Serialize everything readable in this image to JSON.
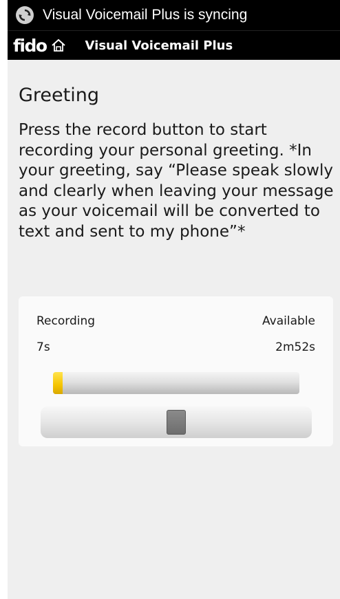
{
  "status_bar": {
    "icon": "sync-icon",
    "text": "Visual Voicemail Plus is syncing"
  },
  "title_bar": {
    "logo": "fido",
    "home_icon": "home-icon",
    "title": "Visual Voicemail Plus"
  },
  "main": {
    "heading": "Greeting",
    "instructions": "Press the record button to start recording your personal greeting. *In your greeting, say “Please speak slowly and clearly when leaving your message as your voicemail will be converted to text and sent to my phone”*",
    "recording": {
      "recording_label": "Recording",
      "available_label": "Available",
      "recording_value": "7s",
      "available_value": "2m52s",
      "progress_fraction": 0.04,
      "slider_fraction": 0.5
    }
  },
  "colors": {
    "accent": "#f5c400",
    "background": "#efefef",
    "bar": "#000000"
  }
}
